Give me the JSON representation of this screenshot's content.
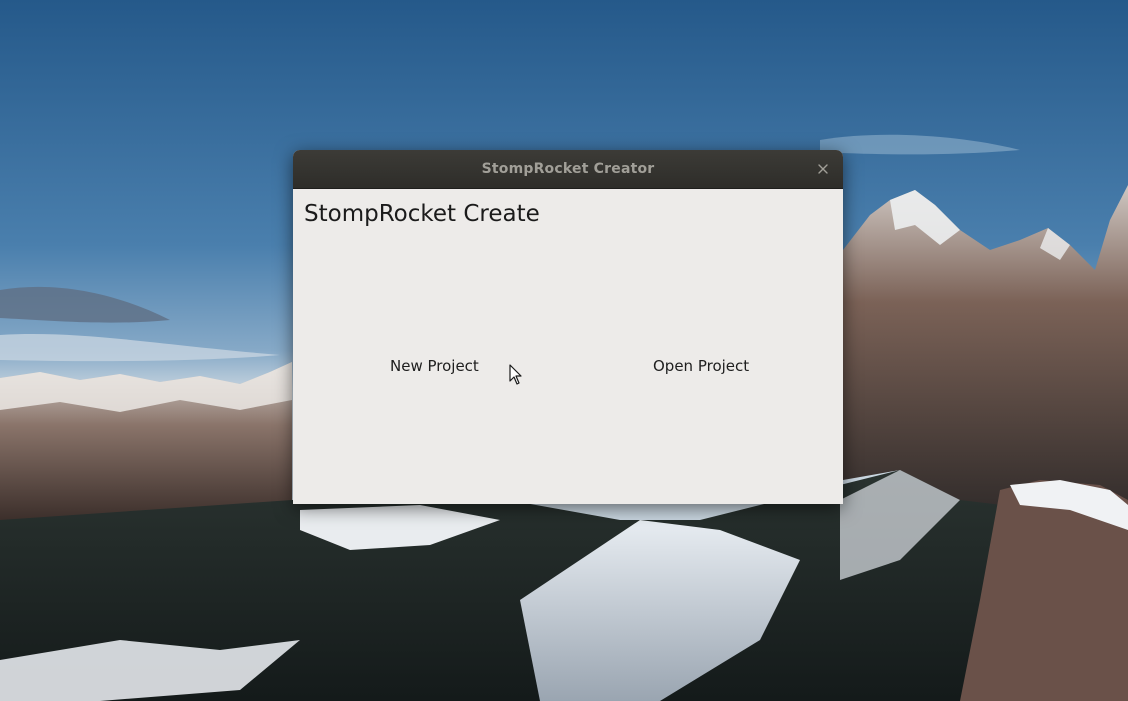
{
  "window": {
    "title": "StompRocket Creator"
  },
  "main": {
    "heading": "StompRocket Create",
    "new_project_label": "New Project",
    "open_project_label": "Open Project"
  },
  "icons": {
    "close": "close-icon",
    "cursor": "mouse-pointer-icon"
  },
  "colors": {
    "titlebar": "#3c3b37",
    "title_text": "#a19f98",
    "window_bg": "#edebe9"
  }
}
